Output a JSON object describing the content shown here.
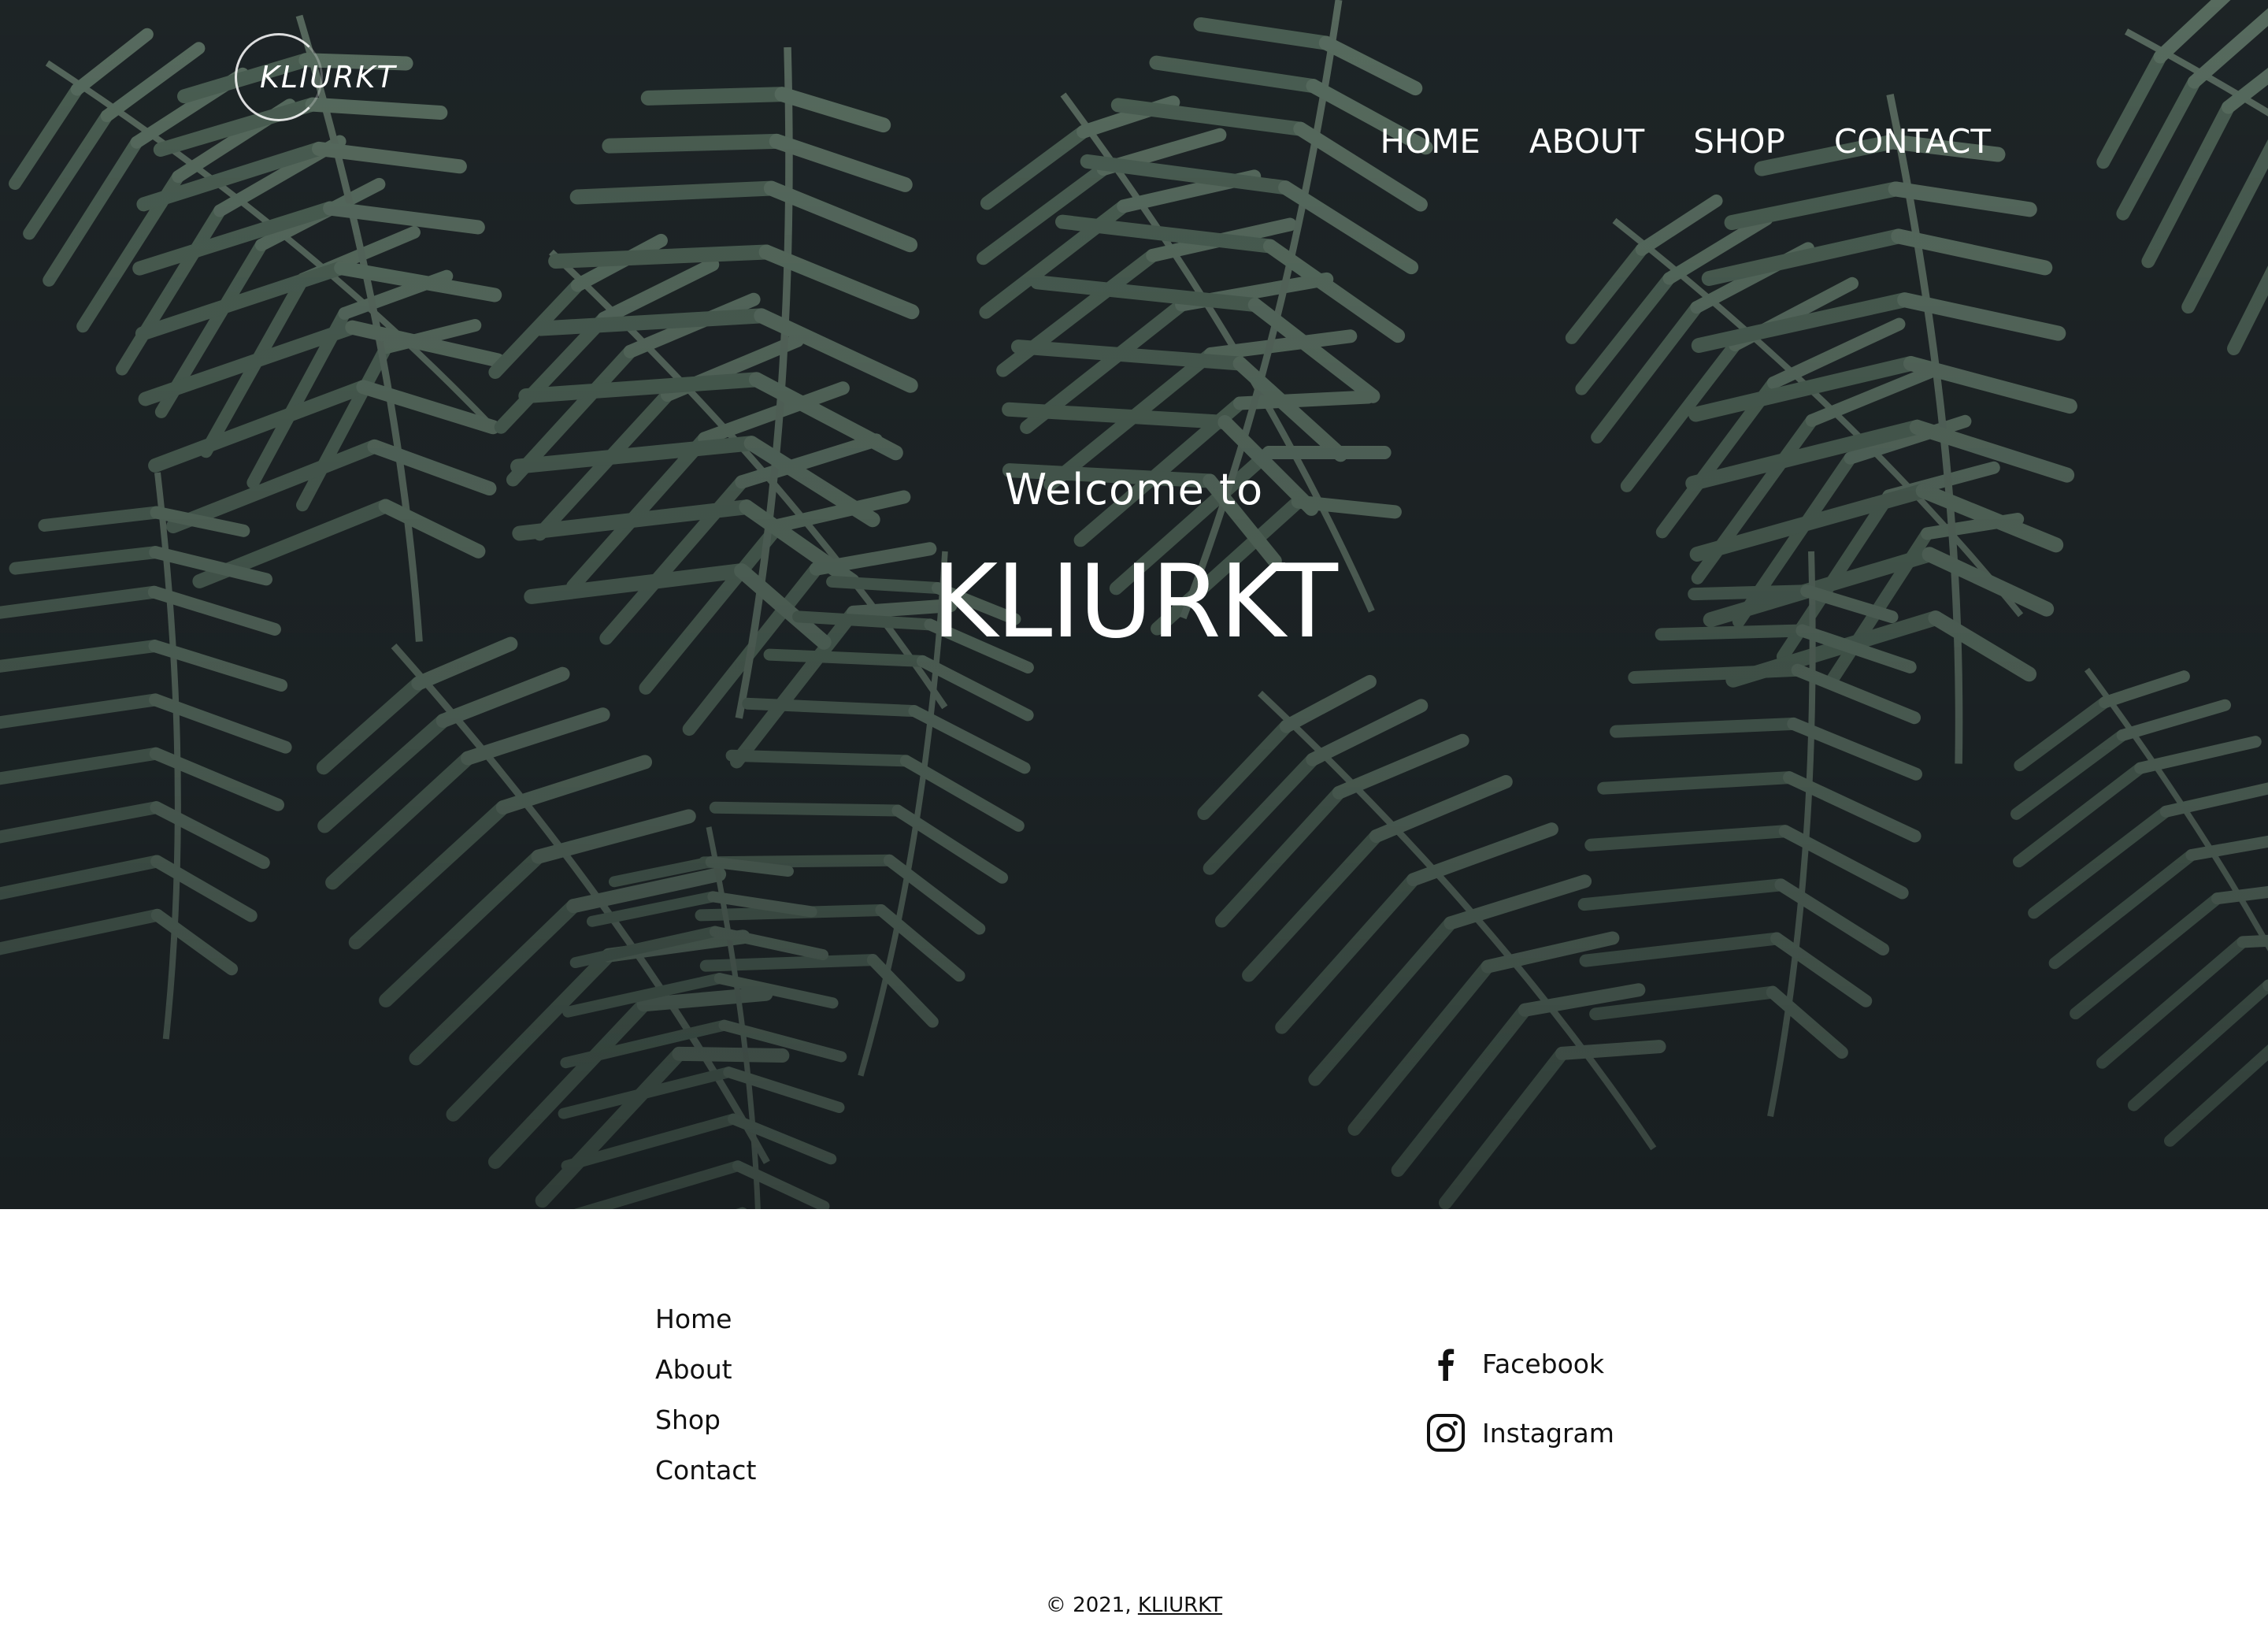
{
  "header": {
    "logo_text": "KLIURKT",
    "nav": {
      "home": "HOME",
      "about": "ABOUT",
      "shop": "SHOP",
      "contact": "CONTACT"
    }
  },
  "hero": {
    "welcome": "Welcome to",
    "brand": "KLIURKT"
  },
  "footer": {
    "links": {
      "home": "Home",
      "about": "About",
      "shop": "Shop",
      "contact": "Contact"
    },
    "social": {
      "facebook": "Facebook",
      "instagram": "Instagram"
    },
    "copyright_prefix": "© 2021,",
    "copyright_link": "KLIURKT"
  },
  "icons": {
    "facebook": "facebook-icon",
    "instagram": "instagram-icon"
  },
  "colors": {
    "hero_dark": "#1b2123",
    "leaf_green": "#4f6656",
    "text_light": "#ffffff",
    "text_dark": "#111111"
  }
}
